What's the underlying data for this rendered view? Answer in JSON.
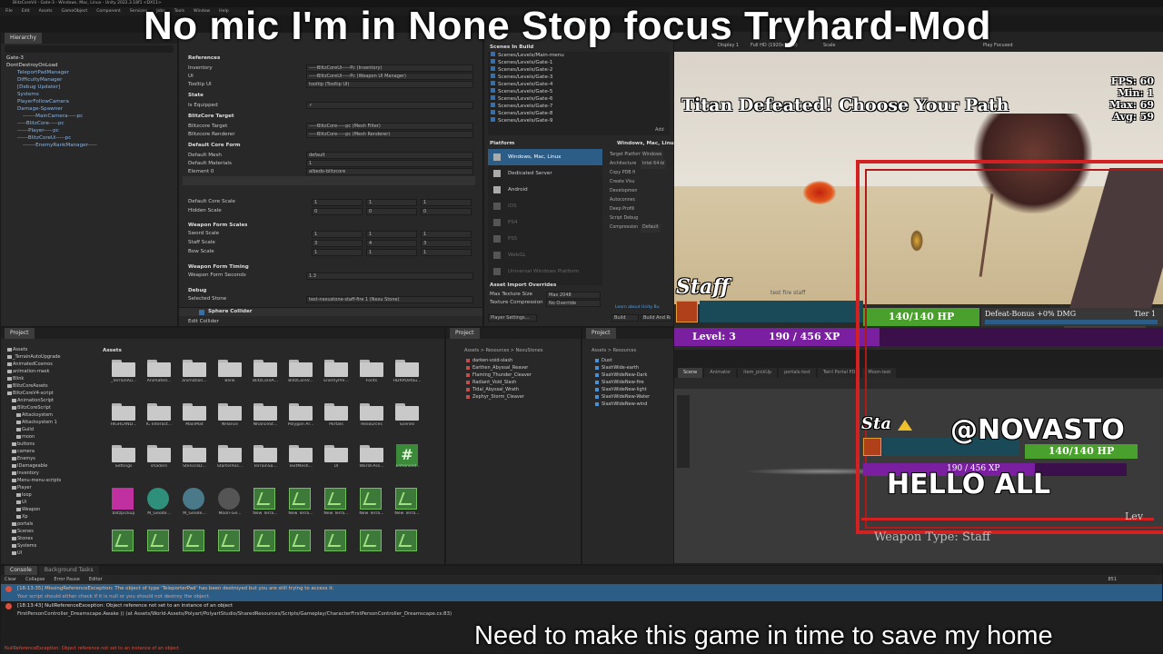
{
  "captions": {
    "top": "No mic I'm in None Stop focus Tryhard-Mod",
    "bottom": "Need to make this game in time to save my home"
  },
  "window": {
    "title": "BlitzCoreV4 - Gate-3 - Windows, Mac, Linux - Unity 2022.3.18f1 <DX11>",
    "menu": [
      "File",
      "Edit",
      "Assets",
      "GameObject",
      "Component",
      "Services",
      "Jobs",
      "Tools",
      "Window",
      "Help"
    ]
  },
  "hierarchy": {
    "tab": "Hierarchy",
    "items": [
      {
        "label": "Gate-3",
        "indent": 0
      },
      {
        "label": "DontDestroyOnLoad",
        "indent": 0
      },
      {
        "label": "TeleportPadManager",
        "indent": 2
      },
      {
        "label": "DifficultyManager",
        "indent": 2
      },
      {
        "label": "[Debug Updater]",
        "indent": 2
      },
      {
        "label": "Systems",
        "indent": 2
      },
      {
        "label": "PlayerFollowCamera",
        "indent": 2
      },
      {
        "label": "Damage-Spawner",
        "indent": 2
      },
      {
        "label": "-------MainCamera-----pc",
        "indent": 3
      },
      {
        "label": "-----BlitzCore-----pc",
        "indent": 2
      },
      {
        "label": "------Player-----pc",
        "indent": 2
      },
      {
        "label": "------BlitzCoreUi-----pc",
        "indent": 2
      },
      {
        "label": "-------EnemyRankManager-----",
        "indent": 3
      }
    ]
  },
  "inspector": {
    "rows": [
      {
        "label": "References",
        "type": "hdr"
      },
      {
        "label": "Inventory",
        "value": "-----BlitzCoreUi-----Pc (Inventory)"
      },
      {
        "label": "UI",
        "value": "-----BlitzCoreUi-----Pc (Weapon UI Manager)"
      },
      {
        "label": "Tooltip UI",
        "value": "tooltip (Tooltip UI)"
      },
      {
        "label": "State",
        "type": "hdr"
      },
      {
        "label": "Is Equipped",
        "value": "✓"
      },
      {
        "label": "BlitzCore Target",
        "type": "hdr"
      },
      {
        "label": "Blitzcore Target",
        "value": "-----BlitzCore-----pc (Mesh Filter)"
      },
      {
        "label": "Blitzcore Renderer",
        "value": "-----BlitzCore-----pc (Mesh Renderer)"
      },
      {
        "label": "Default Core Form",
        "type": "hdr"
      },
      {
        "label": "Default Mesh",
        "value": "default"
      },
      {
        "label": "Default Materials",
        "value": "1"
      },
      {
        "label": "Element 0",
        "value": "albedo-blitzcore"
      }
    ],
    "default_core_scale": {
      "label": "Default Core Scale",
      "x": "1",
      "y": "1",
      "z": "1"
    },
    "hidden_scale": {
      "label": "Hidden Scale",
      "x": "0",
      "y": "0",
      "z": "0"
    },
    "weapon_form_scales": "Weapon Form Scales",
    "sword_scale": {
      "label": "Sword Scale",
      "x": "1",
      "y": "1",
      "z": "1"
    },
    "staff_scale": {
      "label": "Staff Scale",
      "x": "3",
      "y": "4",
      "z": "3"
    },
    "bow_scale": {
      "label": "Bow Scale",
      "x": "1",
      "y": "1",
      "z": "1"
    },
    "weapon_form_timing": "Weapon Form Timing",
    "weapon_form_seconds": {
      "label": "Weapon Form Seconds",
      "value": "1.3"
    },
    "debug": "Debug",
    "selected_stone": {
      "label": "Selected Stone",
      "value": "test-nexustone-staff-fire 1 (Nexu Stone)"
    },
    "sphere_collider": "Sphere Collider",
    "edit_collider": "Edit Collider"
  },
  "build": {
    "title": "Scenes In Build",
    "scenes": [
      "Scenes/Levels/Main-menu",
      "Scenes/Levels/Gate-1",
      "Scenes/Levels/Gate-2",
      "Scenes/Levels/Gate-3",
      "Scenes/Levels/Gate-4",
      "Scenes/Levels/Gate-5",
      "Scenes/Levels/Gate-6",
      "Scenes/Levels/Gate-7",
      "Scenes/Levels/Gate-8",
      "Scenes/Levels/Gate-9"
    ],
    "add_button": "Add",
    "platform_label": "Platform",
    "platforms": [
      "Windows, Mac, Linux",
      "Dedicated Server",
      "Android",
      "iOS",
      "PS4",
      "PS5",
      "WebGL",
      "Universal Windows Platform"
    ],
    "right_title": "Windows, Mac, Linux",
    "right_rows": [
      "Target Platform",
      "Architecture",
      "Copy PDB fi",
      "Create Visu",
      "Developmen",
      "Autoconnec",
      "Deep Profili",
      "Script Debug",
      "Compression"
    ],
    "right_values": [
      "Windows",
      "Intel 64-bi",
      "",
      "",
      "",
      "",
      "",
      "",
      "Default"
    ],
    "asset_import": "Asset Import Overrides",
    "max_texture": {
      "label": "Max Texture Size",
      "value": "Max 2048"
    },
    "texture_compression": {
      "label": "Texture Compression",
      "value": "No Override"
    },
    "player_settings": "Player Settings...",
    "learn_link": "Learn about Unity Bu",
    "build_button": "Build",
    "build_and_run": "Build And Run"
  },
  "game": {
    "toolbar": {
      "display": "Display 1",
      "resolution": "Full HD (1920x1080)",
      "scale": "Scale",
      "play_focused": "Play Focused"
    },
    "fps": [
      "FPS: 60",
      "Min: 1",
      "Max: 69",
      "Avg: 59"
    ],
    "banner": "Titan Defeated! Choose Your Path",
    "weapon": "Staff",
    "stone": "test fire staff",
    "hp": "140/140 HP",
    "defeat_bonus": "Defeat-Bonus +0% DMG",
    "tier": "Tier 1",
    "level": "Level: 3",
    "xp": "190 / 456 XP"
  },
  "scene": {
    "tabs": [
      "Scene",
      "Animator",
      "item_pickUp",
      "portals-test",
      "Twirl Portal PD",
      "Moon-test"
    ],
    "overlay_stat": "Sta",
    "hp": "140/140 HP",
    "xp": "190 / 456 XP",
    "weapon_type": "Weapon Type: Staff",
    "lev": "Lev"
  },
  "webcam": {
    "handle": "@NOVASTO",
    "greeting": "HELLO ALL"
  },
  "project": {
    "tab": "Project",
    "tree": [
      "Assets",
      "_TerrainAutoUpgrade",
      "AnimatedCosmos",
      "animation-mask",
      "Blink",
      "BlitzCoreAssets",
      "BlitzCoreV4-script",
      "AnimationScript",
      "BlitzCoreScript",
      "Attacksystem",
      "Attacksystem 1",
      "Guild",
      "moon",
      "buttons",
      "camera",
      "Enemys",
      "IDamageable",
      "Inventory",
      "Menu-menu-scripts",
      "Player",
      "loop",
      "UI",
      "Weapon",
      "Xp",
      "portals",
      "Scenes",
      "Stones",
      "Systems",
      "UI"
    ],
    "grid_title": "Assets",
    "folders_row1": [
      "_TerrainAu...",
      "Animated...",
      "animation...",
      "Blink",
      "BlitzCoreA...",
      "BlitzCoreV...",
      "EnemyPre...",
      "Fonts",
      "HDRPDefau..."
    ],
    "folders_row2": [
      "HIGHLAND...",
      "IC Interact...",
      "MainMat",
      "NHance",
      "NhanceSt...",
      "Polygon Ar...",
      "Portals",
      "Resources",
      "Scenes"
    ],
    "folders_row3": [
      "Settings",
      "shaders",
      "StencilsD...",
      "StarterAss...",
      "TerrainSa...",
      "TextMesh...",
      "UI",
      "World-Ass...",
      "Enhanced..."
    ],
    "row4": [
      "blitzpickup",
      "M_Geode...",
      "M_Geode...",
      "Moon-Ge...",
      "New Terra...",
      "New Terra...",
      "New Terra...",
      "New Terra...",
      "New Terra..."
    ]
  },
  "project2": {
    "tab": "Project",
    "path": "Assets > Resources > NexuStones",
    "items": [
      "darken-void-slash",
      "Earthen_Abyssal_Reaver",
      "Flaming_Thunder_Cleaver",
      "Radiant_Void_Slash",
      "Tidal_Abyssal_Wrath",
      "Zephyr_Storm_Cleaver"
    ]
  },
  "project3": {
    "tab": "Project",
    "path": "Assets > Resources",
    "items": [
      "Dust",
      "SlashWide-earth",
      "SlashWideNew-Dark",
      "SlashWideNew-fire",
      "SlashWideNew-light",
      "SlashWideNew-Water",
      "SlashWideNew-wind"
    ]
  },
  "console": {
    "tabs": [
      "Console",
      "Background Tasks"
    ],
    "buttons": [
      "Clear",
      "Collapse",
      "Error Pause",
      "Editor"
    ],
    "counts": "851",
    "messages": [
      {
        "line1": "[18:13:35] MissingReferenceException: The object of type 'TeleporterPad' has been destroyed but you are still trying to access it.",
        "line2": "Your script should either check if it is null or you should not destroy the object."
      },
      {
        "line1": "[18:13:43] NullReferenceException: Object reference not set to an instance of an object",
        "line2": "FirstPersonController_Dreamscape.Awake () (at Assets/World-Assets/Polyart/PolyartStudio/SharedResources/Scripts/Gameplay/CharacterFirstPersonController_Dreamscape.cs:83)"
      }
    ],
    "status": "NullReferenceException: Object reference not set to an instance of an object"
  },
  "colors": {
    "accent": "#2c5d87",
    "hp_green": "#4aa02c",
    "xp_purple": "#7a1fa0",
    "frame_red": "#d42020",
    "error_red": "#d9503f"
  }
}
